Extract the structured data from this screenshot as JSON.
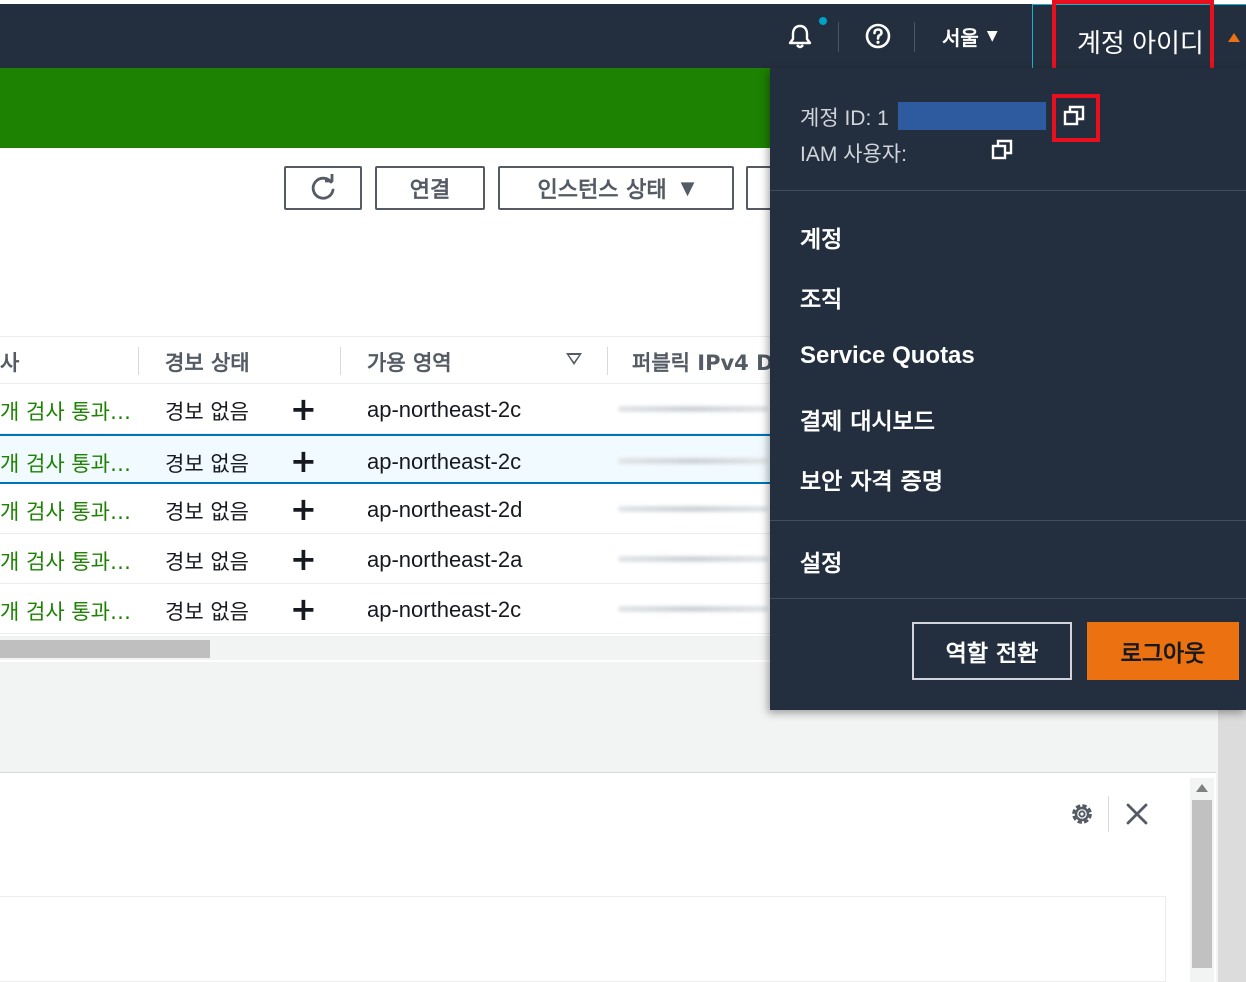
{
  "topnav": {
    "region_label": "서울",
    "region_caret": "▼",
    "account_label": "계정 아이디",
    "notification_dot_color": "#00a1c9",
    "accent_color": "#ec7211"
  },
  "toolbar": {
    "connect_label": "연결",
    "instance_state_label": "인스턴스 상태",
    "instance_state_caret": "▼"
  },
  "table": {
    "columns": [
      "사",
      "경보 상태",
      "가용 영역",
      "퍼블릭 IPv4 D"
    ],
    "rows": [
      {
        "status_check": "개 검사 통과…",
        "alarm": "경보 없음",
        "az": "ap-northeast-2c"
      },
      {
        "status_check": "개 검사 통과…",
        "alarm": "경보 없음",
        "az": "ap-northeast-2c"
      },
      {
        "status_check": "개 검사 통과…",
        "alarm": "경보 없음",
        "az": "ap-northeast-2d"
      },
      {
        "status_check": "개 검사 통과…",
        "alarm": "경보 없음",
        "az": "ap-northeast-2a"
      },
      {
        "status_check": "개 검사 통과…",
        "alarm": "경보 없음",
        "az": "ap-northeast-2c"
      }
    ],
    "plus_glyph": "+"
  },
  "account_menu": {
    "account_id_label": "계정 ID: 1",
    "iam_user_label": "IAM 사용자: ",
    "items": [
      "계정",
      "조직",
      "Service Quotas",
      "결제 대시보드",
      "보안 자격 증명"
    ],
    "settings_label": "설정",
    "switch_role_label": "역할 전환",
    "logout_label": "로그아웃"
  },
  "detail": {
    "close_glyph": "✕"
  },
  "colors": {
    "nav_bg": "#232f3e",
    "flash_green": "#1d8102",
    "highlight_red": "#e8101f",
    "redaction_blue": "#2e5aa0"
  }
}
